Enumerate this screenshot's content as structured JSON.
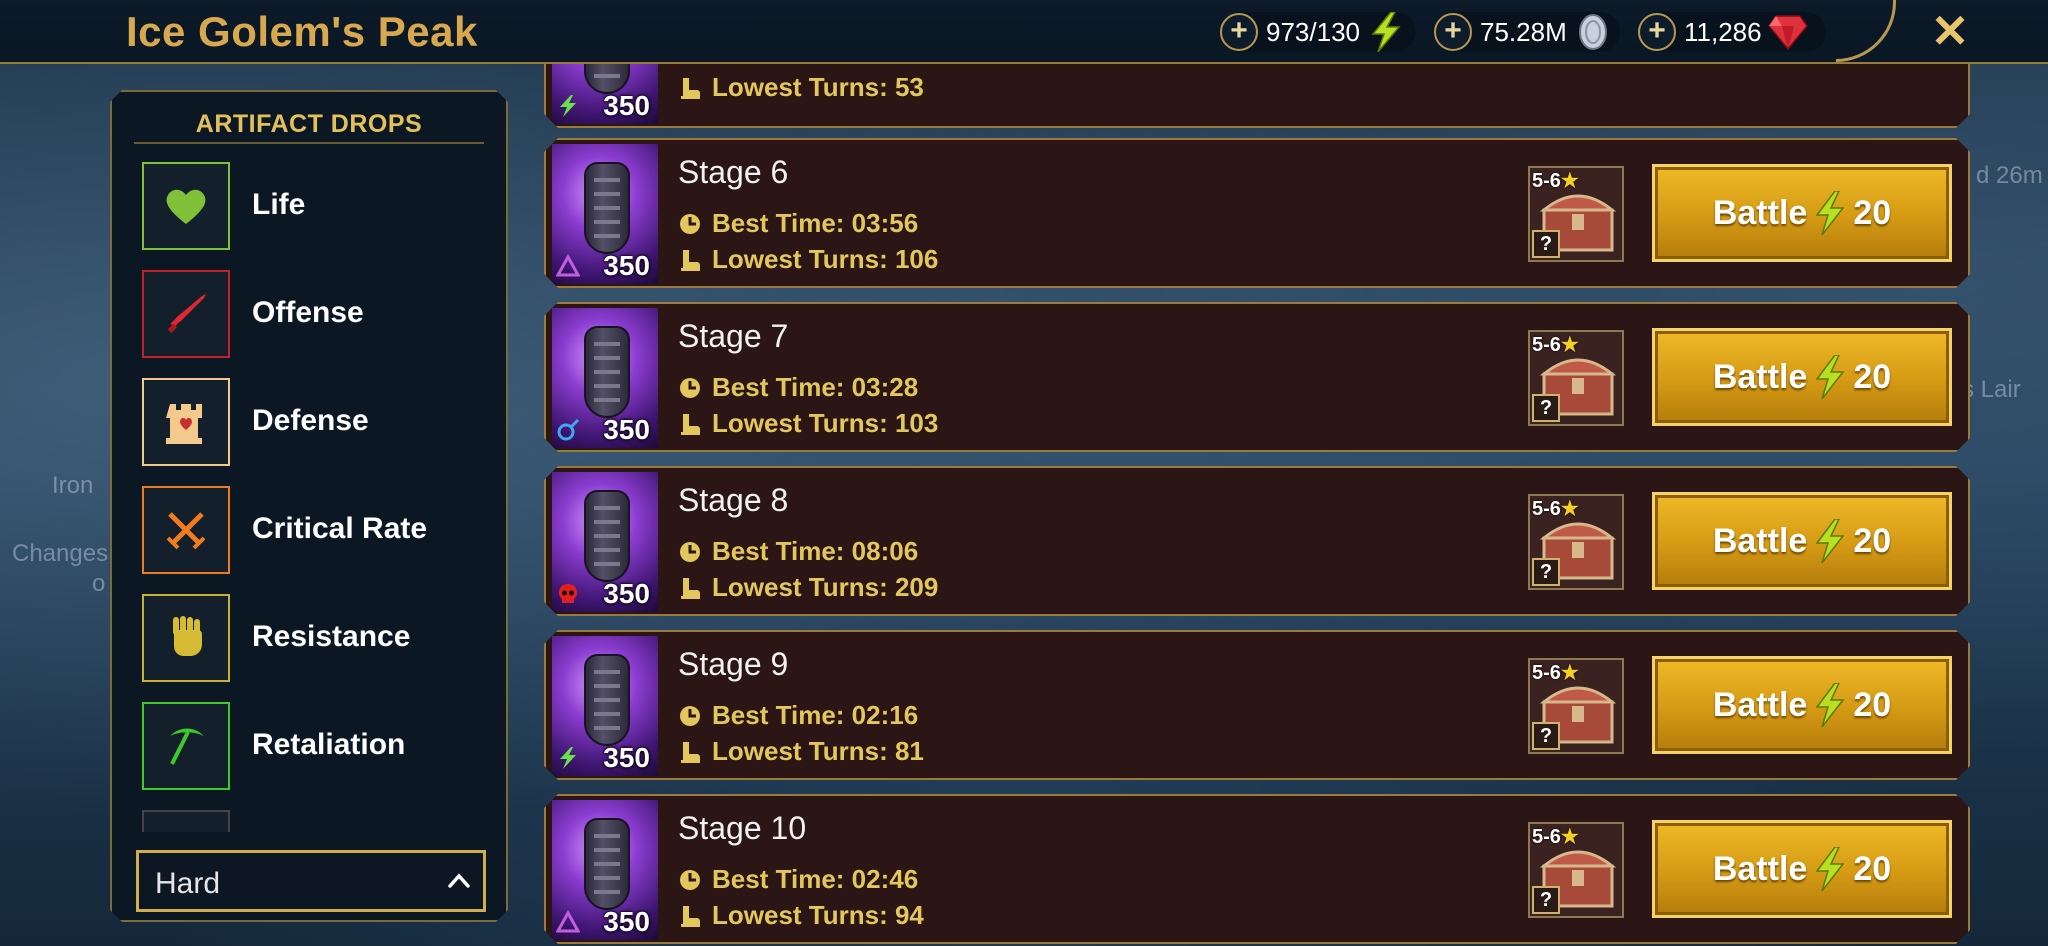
{
  "header": {
    "title": "Ice Golem's Peak",
    "energy": "973/130",
    "silver": "75.28M",
    "gems": "11,286",
    "plus_label": "+",
    "close_label": "✕"
  },
  "background": {
    "left_text_1": "Iron",
    "left_text_2": "Changes",
    "left_text_3": "o",
    "right_text_1": "d 26m",
    "right_text_2": "s Lair"
  },
  "drops_panel": {
    "title": "ARTIFACT DROPS",
    "items": [
      {
        "label": "Life",
        "color": "#7fc23a",
        "icon": "heart-icon"
      },
      {
        "label": "Offense",
        "color": "#c8202a",
        "icon": "sword-icon"
      },
      {
        "label": "Defense",
        "color": "#f3c98c",
        "icon": "tower-icon"
      },
      {
        "label": "Critical Rate",
        "color": "#f07c1e",
        "icon": "crossed-swords-icon"
      },
      {
        "label": "Resistance",
        "color": "#c8b030",
        "icon": "fist-icon"
      },
      {
        "label": "Retaliation",
        "color": "#3ec82a",
        "icon": "pickaxe-icon"
      }
    ],
    "difficulty": "Hard"
  },
  "stages": [
    {
      "name": "",
      "power": "350",
      "affinity": "force",
      "best_time": "",
      "lowest_turns": "Lowest Turns: 53",
      "partial": true
    },
    {
      "name": "Stage 6",
      "power": "350",
      "affinity": "magic",
      "best_time": "Best Time: 03:56",
      "lowest_turns": "Lowest Turns: 106"
    },
    {
      "name": "Stage 7",
      "power": "350",
      "affinity": "spirit",
      "best_time": "Best Time: 03:28",
      "lowest_turns": "Lowest Turns: 103"
    },
    {
      "name": "Stage 8",
      "power": "350",
      "affinity": "void",
      "best_time": "Best Time: 08:06",
      "lowest_turns": "Lowest Turns: 209"
    },
    {
      "name": "Stage 9",
      "power": "350",
      "affinity": "force",
      "best_time": "Best Time: 02:16",
      "lowest_turns": "Lowest Turns: 81"
    },
    {
      "name": "Stage 10",
      "power": "350",
      "affinity": "magic",
      "best_time": "Best Time: 02:46",
      "lowest_turns": "Lowest Turns: 94"
    }
  ],
  "chest": {
    "tier": "5-6",
    "question": "?"
  },
  "battle": {
    "label": "Battle",
    "cost": "20"
  },
  "colors": {
    "accent_gold": "#d8a84e",
    "energy_bolt": "#b8e020",
    "row_bg": "#2b1615",
    "battle_button": "#d49a14"
  }
}
